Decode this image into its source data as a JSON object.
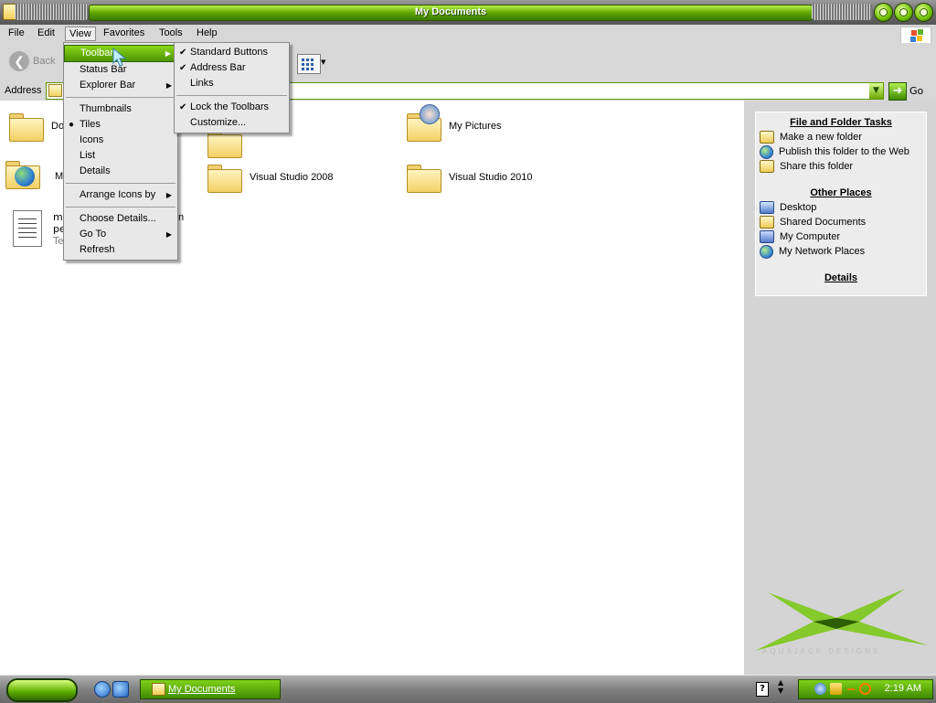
{
  "window": {
    "title": "My Documents"
  },
  "menubar": {
    "items": [
      "File",
      "Edit",
      "View",
      "Favorites",
      "Tools",
      "Help"
    ]
  },
  "toolbar": {
    "back_label": "Back"
  },
  "address": {
    "label": "Address",
    "go_label": "Go"
  },
  "content": {
    "items": [
      {
        "label": "Do"
      },
      {
        "label": "My Pictures"
      },
      {
        "label": "My"
      },
      {
        "label": "Visual Studio 2008"
      },
      {
        "label": "Visual Studio 2010"
      },
      {
        "label_line1": "me",
        "label_line1_tail": "n",
        "label_line2": "pe",
        "label_line3": "Te"
      }
    ]
  },
  "view_menu": {
    "items": [
      {
        "label": "Toolbars",
        "submenu": true,
        "highlighted": true
      },
      {
        "label": "Status Bar"
      },
      {
        "label": "Explorer Bar",
        "submenu": true
      },
      {
        "label": "Thumbnails"
      },
      {
        "label": "Tiles",
        "selected": true
      },
      {
        "label": "Icons"
      },
      {
        "label": "List"
      },
      {
        "label": "Details"
      },
      {
        "label": "Arrange Icons by",
        "submenu": true
      },
      {
        "label": "Choose Details..."
      },
      {
        "label": "Go To",
        "submenu": true
      },
      {
        "label": "Refresh"
      }
    ]
  },
  "toolbars_submenu": {
    "items": [
      {
        "label": "Standard Buttons",
        "checked": true
      },
      {
        "label": "Address Bar",
        "checked": true
      },
      {
        "label": "Links",
        "checked": false
      },
      {
        "label": "Lock the Toolbars",
        "checked": true
      },
      {
        "label": "Customize..."
      }
    ]
  },
  "sidepane": {
    "file_tasks": {
      "title": "File and Folder Tasks",
      "items": [
        "Make a new folder",
        "Publish this folder to the Web",
        "Share this folder"
      ]
    },
    "other_places": {
      "title": "Other Places",
      "items": [
        "Desktop",
        "Shared Documents",
        "My Computer",
        "My Network Places"
      ]
    },
    "details": {
      "title": "Details"
    },
    "logo_text": "AQUAJACK DESIGNS"
  },
  "taskbar": {
    "task_label": "My Documents",
    "clock": "2:19 AM"
  },
  "colors": {
    "accent": "#5ea500",
    "pane": "#d4d4d4",
    "menu_highlight": "#6fb80e"
  }
}
